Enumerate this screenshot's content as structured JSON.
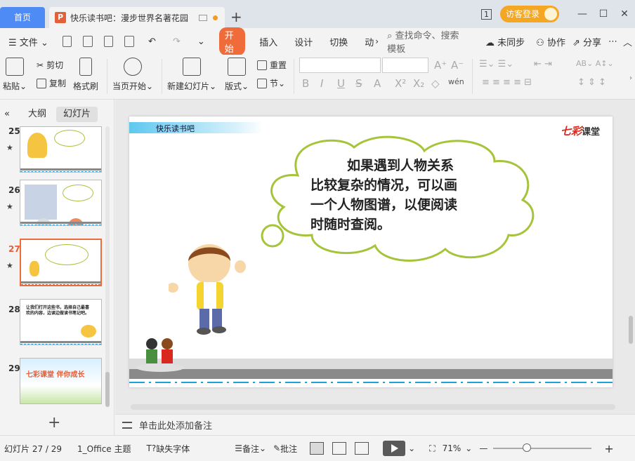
{
  "titlebar": {
    "home_tab": "首页",
    "doc_tab": "快乐读书吧：漫步世界名著花园",
    "doc_icon": "P",
    "new_tab": "+",
    "page_indicator": "1",
    "login": "访客登录",
    "minimize": "—",
    "maximize": "☐",
    "close": "✕"
  },
  "menubar": {
    "file": "文件",
    "items": [
      "开始",
      "插入",
      "设计",
      "切换"
    ],
    "more": "动",
    "search_placeholder": "查找命令、搜索模板",
    "unsync": "未同步",
    "collab": "协作",
    "share": "分享"
  },
  "ribbon": {
    "paste": "粘贴",
    "cut": "剪切",
    "copy": "复制",
    "format_painter": "格式刷",
    "from_current": "当页开始",
    "new_slide": "新建幻灯片",
    "layout": "版式",
    "reset": "重置",
    "section": "节",
    "font_tools": [
      "B",
      "I",
      "U",
      "S",
      "A",
      "X²",
      "X₂",
      "◇",
      "wén"
    ]
  },
  "leftpanel": {
    "collapse": "«",
    "tab_outline": "大纲",
    "tab_slides": "幻灯片",
    "slides": [
      {
        "num": "25",
        "star": "★"
      },
      {
        "num": "26",
        "star": "★"
      },
      {
        "num": "27",
        "star": "★"
      },
      {
        "num": "28",
        "star": ""
      },
      {
        "num": "29",
        "star": ""
      }
    ],
    "thumb28_text": "让我们打开这些书，选择自己最喜欢的内容，边读边做读书笔记吧。",
    "thumb29_text": "七彩课堂  伴你成长",
    "add_slide": "+"
  },
  "slide": {
    "header": "快乐读书吧",
    "brand_red": "七彩",
    "brand_black": "课堂",
    "lines": [
      "如果遇到人物关系",
      "比较复杂的情况，可以画",
      "一个人物图谱，以便阅读",
      "时随时查阅。"
    ]
  },
  "notes": {
    "placeholder": "单击此处添加备注"
  },
  "statusbar": {
    "slide_count": "幻灯片 27 / 29",
    "theme": "1_Office 主题",
    "missing_font": "缺失字体",
    "notes": "备注",
    "comments": "批注",
    "zoom": "71%",
    "zoom_out": "—",
    "zoom_in": "+"
  },
  "colors": {
    "accent": "#ef6c3a",
    "home_tab": "#4e8bf5",
    "login": "#f5a623",
    "cloud_stroke": "#a6c43a"
  }
}
